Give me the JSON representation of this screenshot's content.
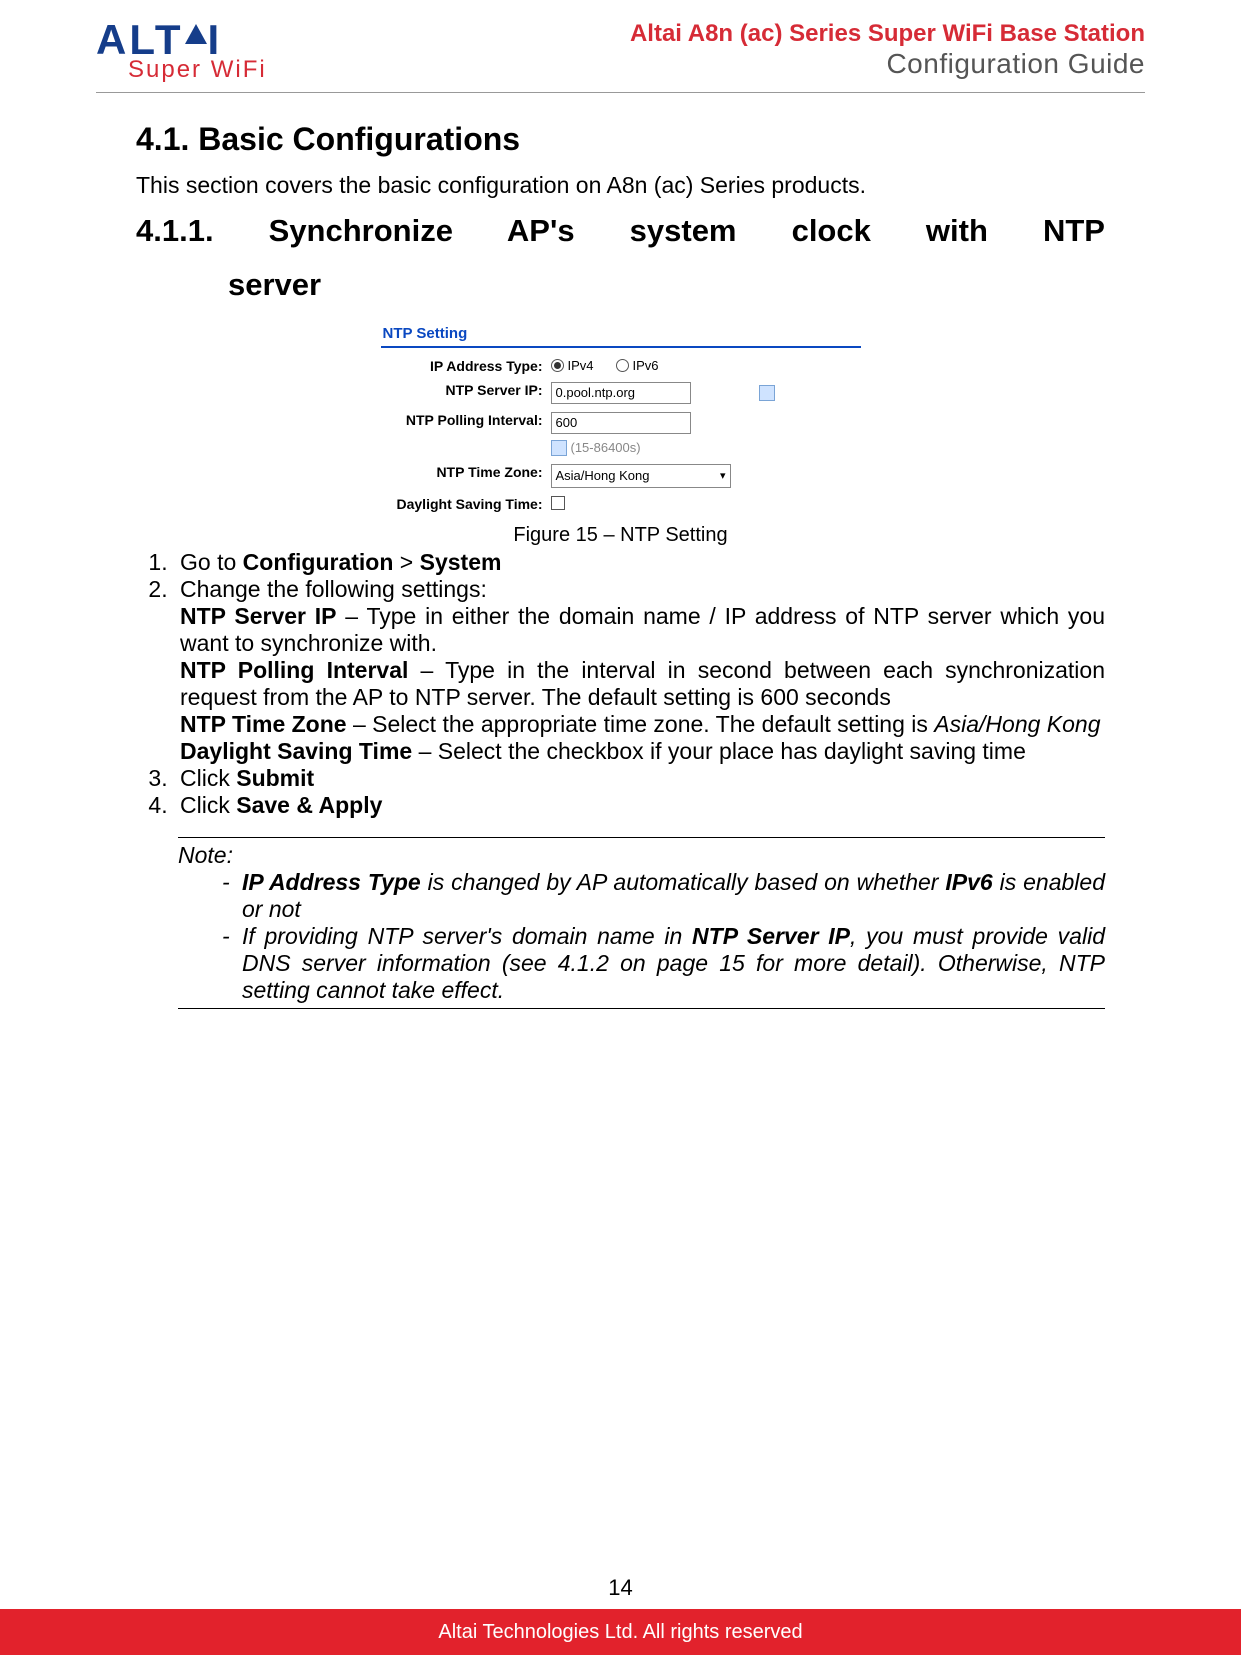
{
  "header": {
    "logo_main_1": "ALT",
    "logo_main_2": "I",
    "logo_sub": "Super WiFi",
    "product_line": "Altai A8n (ac) Series Super WiFi Base Station",
    "doc_title": "Configuration Guide"
  },
  "section": {
    "heading1": "4.1.  Basic Configurations",
    "intro": "This section covers the basic configuration on A8n (ac) Series products.",
    "heading2_line1": "4.1.1.   Synchronize  AP's  system  clock  with  NTP",
    "heading2_line2": "server"
  },
  "ntp_form": {
    "panel_title": "NTP Setting",
    "labels": {
      "ip_address_type": "IP Address Type:",
      "ntp_server_ip": "NTP Server IP:",
      "ntp_polling_interval": "NTP Polling Interval:",
      "ntp_time_zone": "NTP Time Zone:",
      "daylight_saving_time": "Daylight Saving Time:"
    },
    "radio_ipv4": "IPv4",
    "radio_ipv6": "IPv6",
    "server_ip_value": "0.pool.ntp.org",
    "polling_value": "600",
    "polling_hint": "(15-86400s)",
    "timezone_value": "Asia/Hong Kong"
  },
  "figure_caption": "Figure 15 – NTP Setting",
  "steps": {
    "s1_pre": "Go to ",
    "s1_b1": "Configuration",
    "s1_mid": " > ",
    "s1_b2": "System",
    "s2_intro": "Change the following settings:",
    "s2_ntp_server_ip_b": "NTP Server IP",
    "s2_ntp_server_ip_t": " – Type in either the domain name / IP address of NTP server which you want to synchronize with.",
    "s2_polling_b": "NTP Polling Interval",
    "s2_polling_t": " – Type in the interval in second between each synchronization request from the AP to NTP server. The default setting is 600 seconds",
    "s2_tz_b": "NTP Time Zone",
    "s2_tz_t_1": " – Select the appropriate time zone. The default setting is ",
    "s2_tz_i": "Asia/Hong Kong",
    "s2_dst_b": "Daylight Saving Time",
    "s2_dst_t": " – Select the checkbox if your place has daylight saving time",
    "s3_pre": "Click ",
    "s3_b": "Submit",
    "s4_pre": "Click ",
    "s4_b": "Save & Apply"
  },
  "note": {
    "title": "Note:",
    "n1_b": "IP Address Type",
    "n1_t1": " is changed by AP automatically based on whether ",
    "n1_b2": "IPv6",
    "n1_t2": " is enabled or not",
    "n2_t1": "If providing NTP server's domain name in ",
    "n2_b": "NTP Server IP",
    "n2_t2": ", you must provide valid DNS server information (see 4.1.2 on page 15 for more detail). Otherwise, NTP setting cannot take effect."
  },
  "page_number": "14",
  "footer": "Altai Technologies Ltd. All rights reserved"
}
